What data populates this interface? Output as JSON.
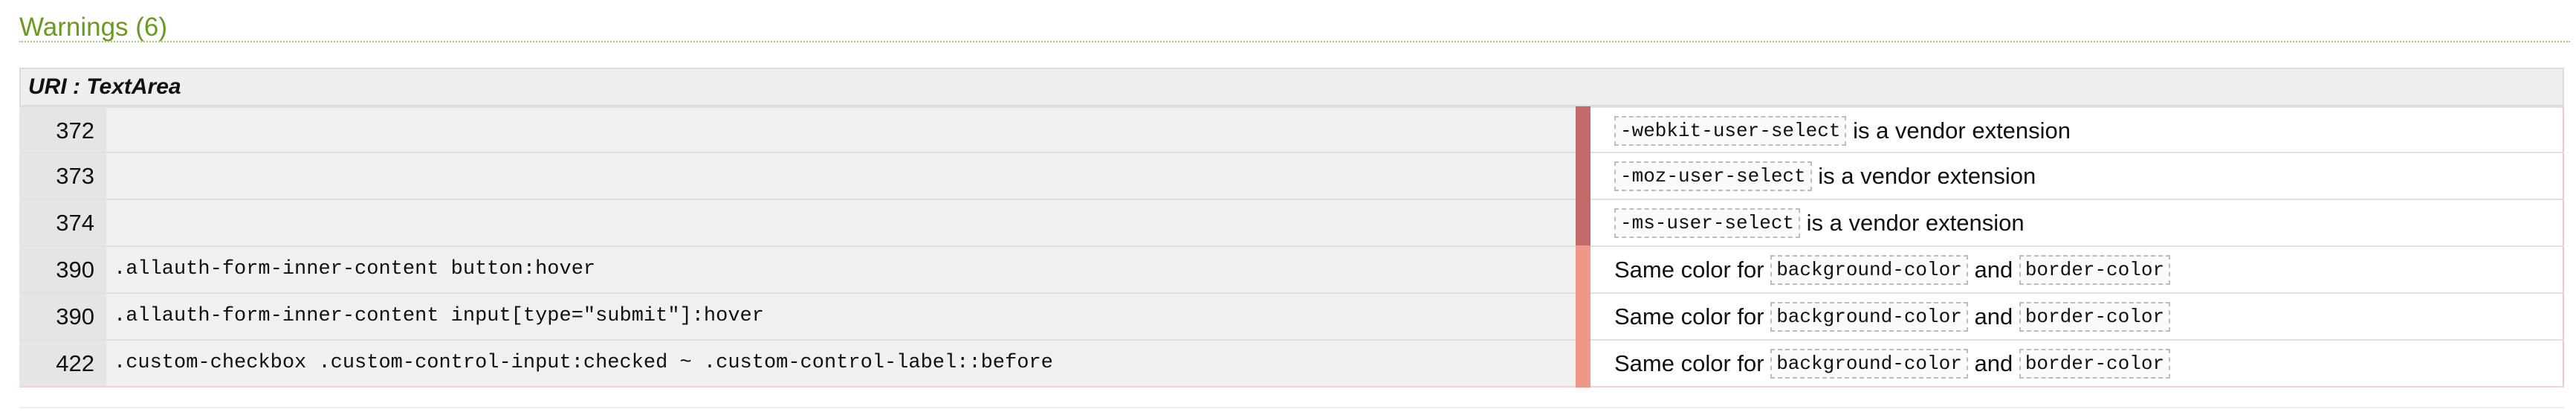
{
  "section": {
    "title": "Warnings (6)"
  },
  "uri_header": "URI : TextArea",
  "colors": {
    "title_green": "#6a9a1f",
    "marker_dark": "#c26a6a",
    "marker_light": "#f0978b"
  },
  "rows": [
    {
      "line": "372",
      "selector": "",
      "marker": "dark",
      "message": {
        "code": "-webkit-user-select",
        "text": "is a vendor extension"
      }
    },
    {
      "line": "373",
      "selector": "",
      "marker": "dark",
      "message": {
        "code": "-moz-user-select",
        "text": "is a vendor extension"
      }
    },
    {
      "line": "374",
      "selector": "",
      "marker": "dark",
      "message": {
        "code": "-ms-user-select",
        "text": "is a vendor extension"
      }
    },
    {
      "line": "390",
      "selector": ".allauth-form-inner-content button:hover",
      "marker": "light",
      "message": {
        "prefix": "Same color for",
        "code1": "background-color",
        "mid": "and",
        "code2": "border-color"
      }
    },
    {
      "line": "390",
      "selector": ".allauth-form-inner-content input[type=\"submit\"]:hover",
      "marker": "light",
      "message": {
        "prefix": "Same color for",
        "code1": "background-color",
        "mid": "and",
        "code2": "border-color"
      }
    },
    {
      "line": "422",
      "selector": ".custom-checkbox .custom-control-input:checked ~ .custom-control-label::before",
      "marker": "light",
      "message": {
        "prefix": "Same color for",
        "code1": "background-color",
        "mid": "and",
        "code2": "border-color"
      }
    }
  ]
}
